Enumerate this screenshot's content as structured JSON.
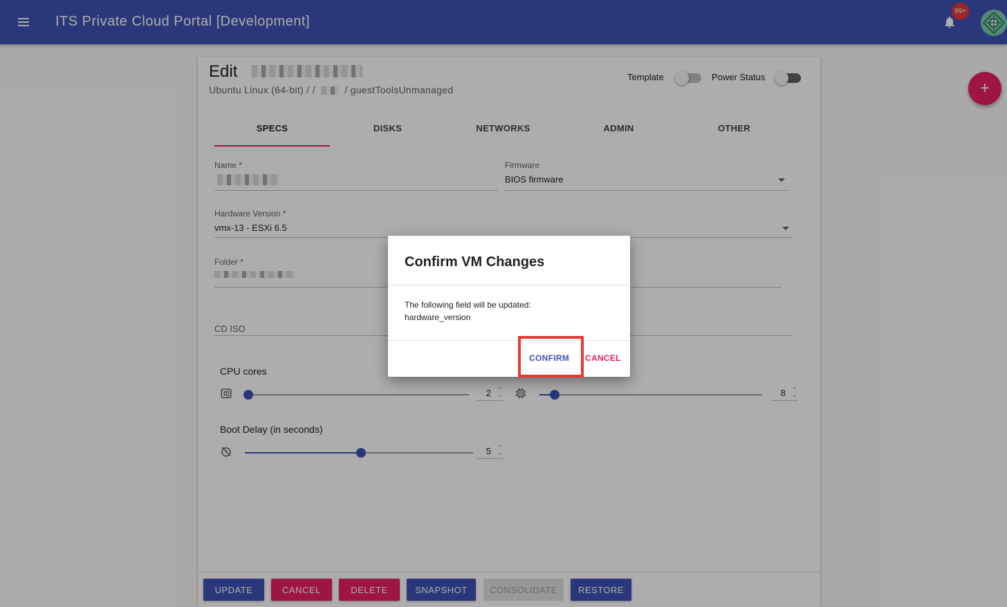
{
  "appbar": {
    "title": "ITS Private Cloud Portal [Development]",
    "notification_count": "99+"
  },
  "vm": {
    "edit_label": "Edit",
    "subtitle": "Ubuntu Linux (64-bit) / /",
    "subtitle_suffix": "/ guestToolsUnmanaged",
    "template_label": "Template",
    "power_label": "Power Status"
  },
  "tabs": [
    "SPECS",
    "DISKS",
    "NETWORKS",
    "ADMIN",
    "OTHER"
  ],
  "form": {
    "name_label": "Name *",
    "firmware_label": "Firmware",
    "firmware_value": "BIOS firmware",
    "hardware_label": "Hardware Version *",
    "hardware_value": "vmx-13 - ESXi 6.5",
    "folder_label": "Folder *",
    "cdiso_label": "CD ISO",
    "cpu_label": "CPU cores",
    "cpu_value": "2",
    "mem_value": "8",
    "boot_label": "Boot Delay (in seconds)",
    "boot_value": "5",
    "cpu_fraction": 0.0,
    "mem_fraction": 0.06,
    "boot_fraction": 0.5
  },
  "footer": {
    "update": "UPDATE",
    "cancel": "CANCEL",
    "delete": "DELETE",
    "snapshot": "SNAPSHOT",
    "consolidate": "CONSOLIDATE",
    "restore": "RESTORE"
  },
  "fab_label": "+",
  "dialog": {
    "title": "Confirm VM Changes",
    "line1": "The following field will be updated:",
    "line2": "hardware_version",
    "confirm": "CONFIRM",
    "cancel": "CANCEL"
  },
  "colors": {
    "primary": "#3f51b5",
    "accent": "#e91e63",
    "highlight": "#e53935"
  }
}
